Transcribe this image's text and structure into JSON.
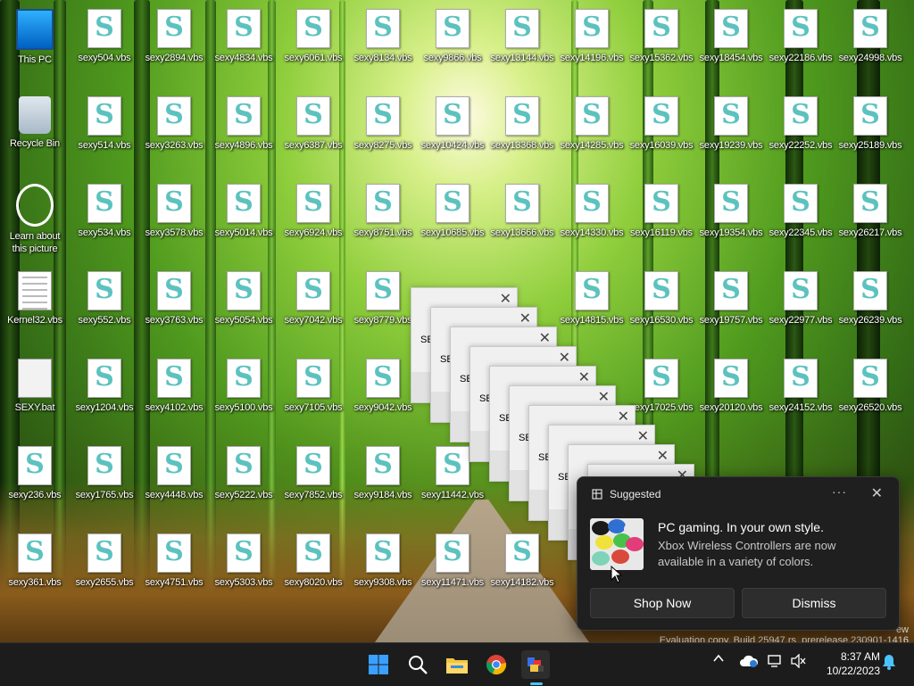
{
  "desktop": {
    "system_icons": [
      {
        "label": "This PC",
        "icon": "this-pc-icon"
      },
      {
        "label": "Recycle Bin",
        "icon": "recycle-bin-icon"
      },
      {
        "label": "Learn about this picture",
        "icon": "learn-about-picture-icon"
      },
      {
        "label": "Kernel32.vbs",
        "icon": "text-document-icon"
      },
      {
        "label": "SEXY.bat",
        "icon": "batch-file-icon"
      },
      {
        "label": "sexy236.vbs",
        "icon": "vbs-script-icon"
      },
      {
        "label": "sexy361.vbs",
        "icon": "vbs-script-icon"
      }
    ],
    "vbs_columns": [
      [
        "sexy504.vbs",
        "sexy514.vbs",
        "sexy534.vbs",
        "sexy552.vbs",
        "sexy1204.vbs",
        "sexy1765.vbs",
        "sexy2655.vbs"
      ],
      [
        "sexy2894.vbs",
        "sexy3263.vbs",
        "sexy3578.vbs",
        "sexy3763.vbs",
        "sexy4102.vbs",
        "sexy4448.vbs",
        "sexy4751.vbs"
      ],
      [
        "sexy4834.vbs",
        "sexy4896.vbs",
        "sexy5014.vbs",
        "sexy5054.vbs",
        "sexy5100.vbs",
        "sexy5222.vbs",
        "sexy5303.vbs"
      ],
      [
        "sexy6061.vbs",
        "sexy6387.vbs",
        "sexy6924.vbs",
        "sexy7042.vbs",
        "sexy7105.vbs",
        "sexy7852.vbs",
        "sexy8020.vbs"
      ],
      [
        "sexy8134.vbs",
        "sexy8275.vbs",
        "sexy8751.vbs",
        "sexy8779.vbs",
        "sexy9042.vbs",
        "sexy9184.vbs",
        "sexy9308.vbs"
      ],
      [
        "sexy9866.vbs",
        "sexy10424.vbs",
        "sexy10685.vbs",
        "",
        "",
        "sexy11442.vbs",
        "sexy11471.vbs"
      ],
      [
        "sexy13144.vbs",
        "sexy13368.vbs",
        "sexy13666.vbs",
        "",
        "",
        "",
        "sexy14182.vbs"
      ],
      [
        "sexy14196.vbs",
        "sexy14285.vbs",
        "sexy14330.vbs",
        "sexy14815.vbs",
        "",
        "",
        ""
      ],
      [
        "sexy15362.vbs",
        "sexy16039.vbs",
        "sexy16119.vbs",
        "sexy16530.vbs",
        "sexy17025.vbs",
        "",
        ""
      ],
      [
        "sexy18454.vbs",
        "sexy19239.vbs",
        "sexy19354.vbs",
        "sexy19757.vbs",
        "sexy20120.vbs",
        "",
        ""
      ],
      [
        "sexy22186.vbs",
        "sexy22252.vbs",
        "sexy22345.vbs",
        "sexy22977.vbs",
        "sexy24152.vbs",
        "",
        ""
      ],
      [
        "sexy24998.vbs",
        "sexy25189.vbs",
        "sexy26217.vbs",
        "sexy26239.vbs",
        "sexy26520.vbs",
        "",
        ""
      ]
    ]
  },
  "message_boxes": {
    "text_prefix": "SE",
    "close_glyph": "✕",
    "count": 10
  },
  "toast": {
    "header": "Suggested",
    "more_glyph": "···",
    "close_glyph": "✕",
    "title": "PC gaming. In your own style.",
    "body": "Xbox Wireless Controllers are now available in a variety of colors.",
    "primary_button": "Shop Now",
    "secondary_button": "Dismiss",
    "image_icon": "xbox-controllers-image",
    "controller_colors": [
      "#1a1a1a",
      "#2f6fd1",
      "#e8e8e8",
      "#f0e23a",
      "#46c24a",
      "#e23c7a",
      "#7fd3b8",
      "#d94a3a"
    ]
  },
  "watermark": {
    "line1": "Evaluation copy. Build 25947.rs_prerelease.230901-1416",
    "line_partial": "ew"
  },
  "taskbar": {
    "apps": [
      {
        "name": "start",
        "icon": "windows-start-icon"
      },
      {
        "name": "search",
        "icon": "search-icon"
      },
      {
        "name": "file-explorer",
        "icon": "folder-icon"
      },
      {
        "name": "chrome",
        "icon": "chrome-icon"
      },
      {
        "name": "running-app",
        "icon": "script-app-icon"
      }
    ],
    "tray": {
      "chevron": "^",
      "time": "8:37 AM",
      "date": "10/22/2023"
    }
  },
  "colors": {
    "taskbar_bg": "#1c1c1c",
    "toast_bg": "#1f1f1f",
    "vbs_glyph": "#5cc2bf",
    "accent": "#0078d4"
  }
}
